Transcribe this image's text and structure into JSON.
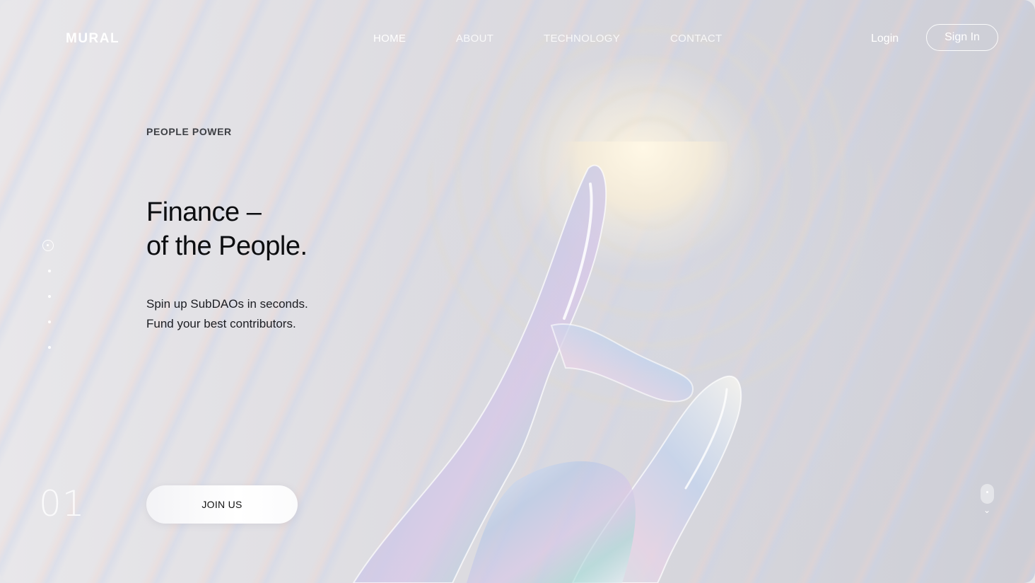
{
  "brand": {
    "logo": "MURAL"
  },
  "nav": {
    "items": [
      {
        "label": "HOME",
        "active": true
      },
      {
        "label": "ABOUT",
        "active": false
      },
      {
        "label": "TECHNOLOGY",
        "active": false
      },
      {
        "label": "CONTACT",
        "active": false
      }
    ]
  },
  "auth": {
    "login_label": "Login",
    "signin_label": "Sign In"
  },
  "hero": {
    "eyebrow": "PEOPLE POWER",
    "headline_line1": "Finance –",
    "headline_line2": "of the People.",
    "sub_line1": "Spin up SubDAOs in seconds.",
    "sub_line2": "Fund your best contributors.",
    "cta_label": "JOIN US"
  },
  "slider": {
    "current_slide": "01",
    "total_dots": 5,
    "active_dot": 1
  },
  "icons": {
    "slide_dot_active": "radio-dot-icon",
    "scroll_mouse": "mouse-scroll-icon",
    "scroll_chevron": "chevron-down-icon"
  },
  "colors": {
    "text_dark": "#0c0d10",
    "eyebrow": "#3d3f44",
    "nav_text": "#ffffff",
    "cta_bg": "#ffffff"
  }
}
